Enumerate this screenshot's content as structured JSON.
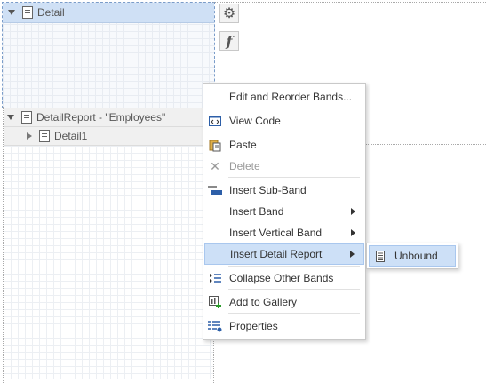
{
  "bands": {
    "detail": "Detail",
    "detail_report": "DetailReport - \"Employees\"",
    "detail1": "Detail1"
  },
  "side_tools": {
    "settings_icon": "gear-icon",
    "function_icon": "function-icon",
    "function_glyph": "f"
  },
  "context_menu": {
    "items": [
      {
        "label": "Edit and Reorder Bands...",
        "icon": ""
      },
      {
        "label": "View Code",
        "icon": "code-icon"
      },
      {
        "label": "Paste",
        "icon": "paste-icon"
      },
      {
        "label": "Delete",
        "icon": "delete-icon",
        "disabled": true
      },
      {
        "label": "Insert Sub-Band",
        "icon": "sub-band-icon"
      },
      {
        "label": "Insert Band",
        "icon": "",
        "submenu": true
      },
      {
        "label": "Insert Vertical Band",
        "icon": "",
        "submenu": true
      },
      {
        "label": "Insert Detail Report",
        "icon": "",
        "submenu": true,
        "highlighted": true
      },
      {
        "label": "Collapse Other Bands",
        "icon": "collapse-icon"
      },
      {
        "label": "Add to Gallery",
        "icon": "gallery-icon"
      },
      {
        "label": "Properties",
        "icon": "properties-icon"
      }
    ]
  },
  "submenu": {
    "items": [
      {
        "label": "Unbound",
        "icon": "document-icon"
      }
    ]
  },
  "colors": {
    "highlight": "#cde0f7",
    "band_header": "#cfe0f5"
  }
}
